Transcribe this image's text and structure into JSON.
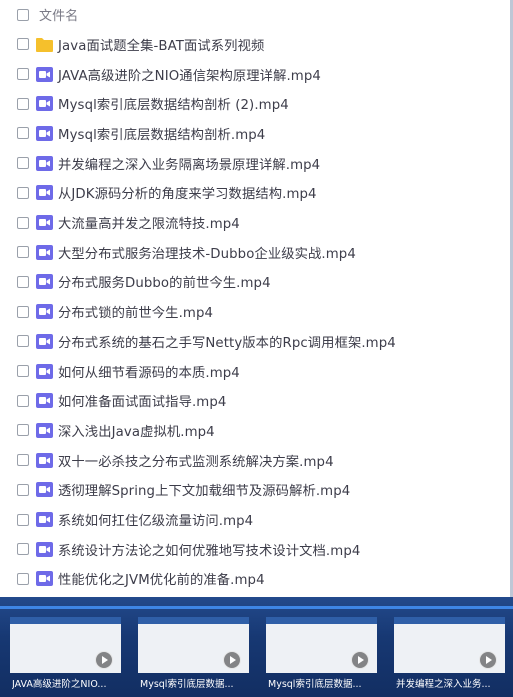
{
  "header": {
    "label": "文件名"
  },
  "files": [
    {
      "name": "Java面试题全集-BAT面试系列视频",
      "icon": "folder-icon",
      "type": "folder"
    },
    {
      "name": "JAVA高级进阶之NIO通信架构原理详解.mp4",
      "icon": "video-file-icon",
      "type": "video"
    },
    {
      "name": "Mysql索引底层数据结构剖析 (2).mp4",
      "icon": "video-file-icon",
      "type": "video"
    },
    {
      "name": "Mysql索引底层数据结构剖析.mp4",
      "icon": "video-file-icon",
      "type": "video"
    },
    {
      "name": "并发编程之深入业务隔离场景原理详解.mp4",
      "icon": "video-file-icon",
      "type": "video"
    },
    {
      "name": "从JDK源码分析的角度来学习数据结构.mp4",
      "icon": "video-file-icon",
      "type": "video"
    },
    {
      "name": "大流量高并发之限流特技.mp4",
      "icon": "video-file-icon",
      "type": "video"
    },
    {
      "name": "大型分布式服务治理技术-Dubbo企业级实战.mp4",
      "icon": "video-file-icon",
      "type": "video"
    },
    {
      "name": "分布式服务Dubbo的前世今生.mp4",
      "icon": "video-file-icon",
      "type": "video"
    },
    {
      "name": "分布式锁的前世今生.mp4",
      "icon": "video-file-icon",
      "type": "video"
    },
    {
      "name": "分布式系统的基石之手写Netty版本的Rpc调用框架.mp4",
      "icon": "video-file-icon",
      "type": "video"
    },
    {
      "name": "如何从细节看源码的本质.mp4",
      "icon": "video-file-icon",
      "type": "video"
    },
    {
      "name": "如何准备面试面试指导.mp4",
      "icon": "video-file-icon",
      "type": "video"
    },
    {
      "name": "深入浅出Java虚拟机.mp4",
      "icon": "video-file-icon",
      "type": "video"
    },
    {
      "name": "双十一必杀技之分布式监测系统解决方案.mp4",
      "icon": "video-file-icon",
      "type": "video"
    },
    {
      "name": "透彻理解Spring上下文加载细节及源码解析.mp4",
      "icon": "video-file-icon",
      "type": "video"
    },
    {
      "name": "系统如何扛住亿级流量访问.mp4",
      "icon": "video-file-icon",
      "type": "video"
    },
    {
      "name": "系统设计方法论之如何优雅地写技术设计文档.mp4",
      "icon": "video-file-icon",
      "type": "video"
    },
    {
      "name": "性能优化之JVM优化前的准备.mp4",
      "icon": "video-file-icon",
      "type": "video"
    }
  ],
  "thumbnails": [
    {
      "label": "JAVA高级进阶之NIO..."
    },
    {
      "label": "Mysql索引底层数据..."
    },
    {
      "label": "Mysql索引底层数据..."
    },
    {
      "label": "并发编程之深入业务..."
    }
  ],
  "colors": {
    "folder": "#f5c02c",
    "video": "#6e6ae8",
    "strip": "#173873",
    "accent": "#3e86e6"
  }
}
